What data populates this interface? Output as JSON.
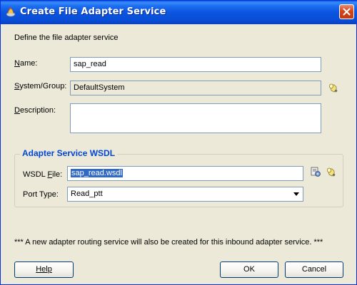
{
  "window": {
    "title": "Create File Adapter Service"
  },
  "intro": "Define the file adapter service",
  "name": {
    "label_mnemonic": "N",
    "label_rest": "ame:",
    "value": "sap_read"
  },
  "system_group": {
    "label_mnemonic": "S",
    "label_rest": "ystem/Group:",
    "value": "DefaultSystem",
    "browse_icon": "flashlight-icon"
  },
  "description": {
    "label_mnemonic": "D",
    "label_rest": "escription:",
    "value": ""
  },
  "wsdl_group": {
    "title": "Adapter Service WSDL",
    "wsdl_file": {
      "label_pre": "WSDL ",
      "label_mnemonic": "F",
      "label_rest": "ile:",
      "value": "sap_read.wsdl",
      "edit_icon": "wsdl-edit-icon",
      "browse_icon": "flashlight-icon"
    },
    "port_type": {
      "label_pre": "Port Type:",
      "value": "Read_ptt"
    }
  },
  "note": "*** A new adapter routing service will also be created for this inbound adapter service. ***",
  "buttons": {
    "help": "Help",
    "ok": "OK",
    "cancel": "Cancel"
  },
  "colors": {
    "title_bar": "#0a55e0",
    "group_title": "#0046d5",
    "selection": "#316ac5",
    "dialog_bg": "#ece9d8"
  }
}
